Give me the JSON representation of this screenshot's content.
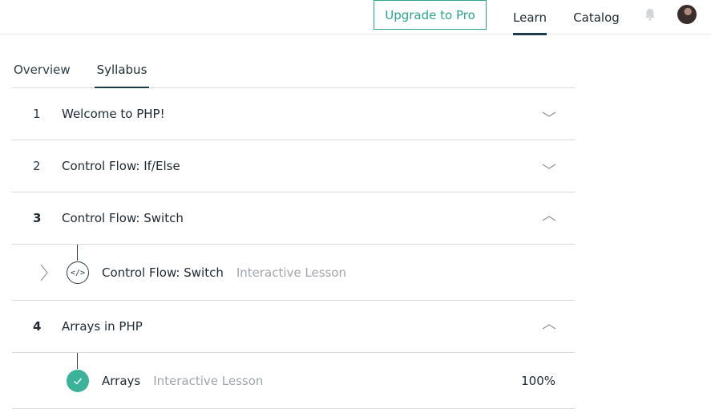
{
  "header": {
    "upgrade_label": "Upgrade to Pro",
    "nav": {
      "learn": "Learn",
      "catalog": "Catalog"
    },
    "accent_color": "#2da58e",
    "icons": {
      "notifications": "bell-icon",
      "profile": "avatar"
    }
  },
  "tabs": {
    "overview": "Overview",
    "syllabus": "Syllabus",
    "active": "Syllabus"
  },
  "modules": [
    {
      "number": "1",
      "title": "Welcome to PHP!",
      "expanded": false
    },
    {
      "number": "2",
      "title": "Control Flow: If/Else",
      "expanded": false
    },
    {
      "number": "3",
      "title": "Control Flow: Switch",
      "expanded": true
    },
    {
      "number": "4",
      "title": "Arrays in PHP",
      "expanded": true
    }
  ],
  "lessons": [
    {
      "title": "Control Flow: Switch",
      "type": "Interactive Lesson",
      "icon": "code-icon",
      "completed": false
    },
    {
      "title": "Arrays",
      "type": "Interactive Lesson",
      "icon": "checkmark-icon",
      "completed": true,
      "progress": "100%"
    }
  ],
  "colors": {
    "complete": "#3bb39b",
    "muted_text": "#a0a6ab",
    "underline": "#1f3a4a"
  }
}
